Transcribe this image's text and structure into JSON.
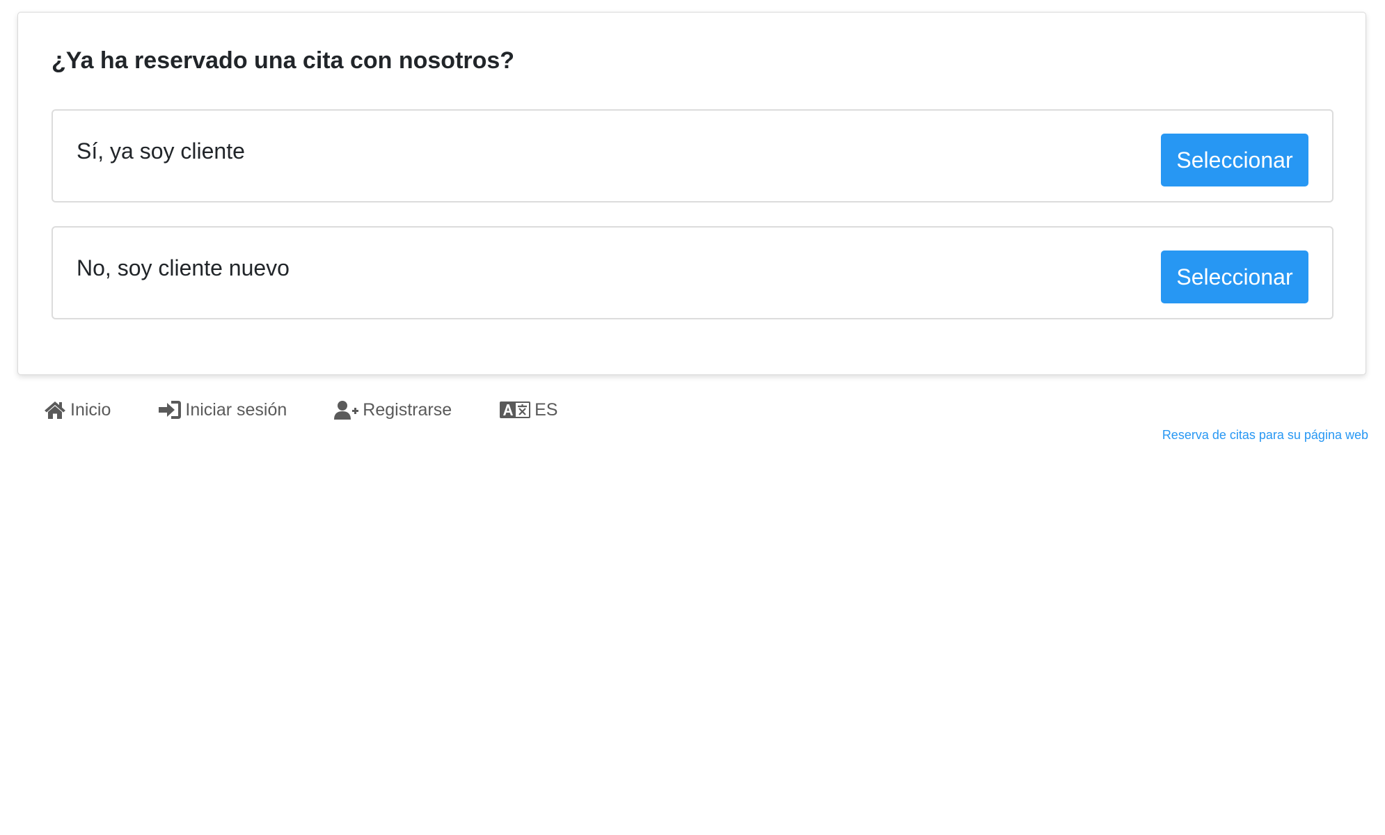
{
  "question": "¿Ya ha reservado una cita con nosotros?",
  "options": [
    {
      "label": "Sí, ya soy cliente",
      "button": "Seleccionar"
    },
    {
      "label": "No, soy cliente nuevo",
      "button": "Seleccionar"
    }
  ],
  "footer": {
    "links": [
      {
        "icon": "home-icon",
        "label": "Inicio"
      },
      {
        "icon": "sign-in-icon",
        "label": "Iniciar sesión"
      },
      {
        "icon": "user-plus-icon",
        "label": "Registrarse"
      },
      {
        "icon": "language-icon",
        "label": "ES"
      }
    ],
    "credit": "Reserva de citas para su página web"
  },
  "colors": {
    "primary": "#2797f3",
    "text": "#212529",
    "muted": "#5a5a5a",
    "border": "#dcdcdc"
  }
}
